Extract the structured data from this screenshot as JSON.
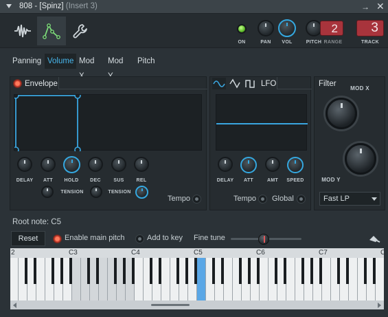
{
  "window": {
    "title_main": "808 - [Spinz]",
    "title_insert": "(Insert 3)",
    "arrow_glyph": "→",
    "close_glyph": "✕"
  },
  "toolbar": {
    "icons": [
      "waveform-icon",
      "envelope-icon",
      "wrench-icon"
    ],
    "knob_labels": {
      "on": "ON",
      "pan": "PAN",
      "vol": "VOL",
      "pitch": "PITCH",
      "range": "RANGE",
      "track": "TRACK"
    },
    "range_value": "2",
    "track_value": "3"
  },
  "tabs": [
    "Panning",
    "Volume",
    "Mod X",
    "Mod Y",
    "Pitch"
  ],
  "active_tab": "Volume",
  "envelope": {
    "title": "Envelope",
    "knobs": [
      "DELAY",
      "ATT",
      "HOLD",
      "DEC",
      "SUS",
      "REL"
    ],
    "tension_label": "TENSION",
    "tempo_label": "Tempo"
  },
  "lfo": {
    "title": "LFO",
    "knobs": [
      "DELAY",
      "ATT",
      "AMT",
      "SPEED"
    ],
    "tempo_label": "Tempo",
    "global_label": "Global"
  },
  "filter": {
    "title": "Filter",
    "mod_x_label": "MOD X",
    "mod_y_label": "MOD Y",
    "type_value": "Fast LP"
  },
  "root_note": {
    "label": "Root note: C5",
    "reset_label": "Reset",
    "enable_main_pitch_label": "Enable main pitch",
    "add_to_key_label": "Add to key",
    "fine_tune_label": "Fine tune"
  },
  "piano": {
    "octave_labels": [
      "2",
      "C3",
      "C4",
      "C5",
      "C6",
      "C7",
      "C"
    ],
    "highlight_color": "#5aa7e6"
  },
  "colors": {
    "accent": "#35a8e0",
    "track_box": "#a8343c",
    "on_led": "#7ddc4a"
  }
}
